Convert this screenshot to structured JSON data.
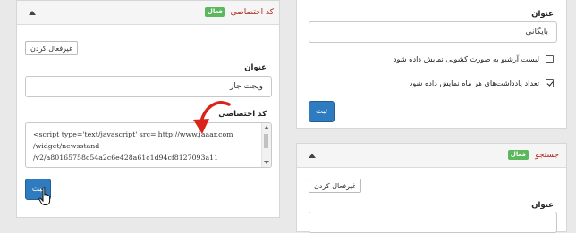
{
  "left_panel": {
    "title": "کد اختصاصی",
    "badge": "فعال",
    "disable_button": "غیرفعال کردن",
    "title_label": "عنوان",
    "title_value": "ویجت جار",
    "code_label": "کد اختصاصی",
    "code_lines": [
      "<script type='text/javascript' src='http://www.jaaar.com",
      "/widget/newsstand",
      "/v2/a80165758c54a2c6e428a61c1d94cf8127093a11"
    ],
    "submit": "ثبت"
  },
  "right_panel_top": {
    "title_label": "عنوان",
    "title_value": "بایگانی",
    "options": [
      {
        "label": "لیست آرشیو به صورت کشویی نمایش داده شود",
        "checked": false
      },
      {
        "label": "تعداد یادداشت‌های هر ماه نمایش داده شود",
        "checked": true
      }
    ],
    "submit": "ثبت"
  },
  "right_panel_search": {
    "title": "جستجو",
    "badge": "فعال",
    "disable_button": "غیرفعال کردن",
    "title_label": "عنوان"
  },
  "colors": {
    "panel_title": "#b3261e",
    "badge": "#5cb85c",
    "submit": "#2f7bbf",
    "annotation_arrow": "#d9241b"
  }
}
